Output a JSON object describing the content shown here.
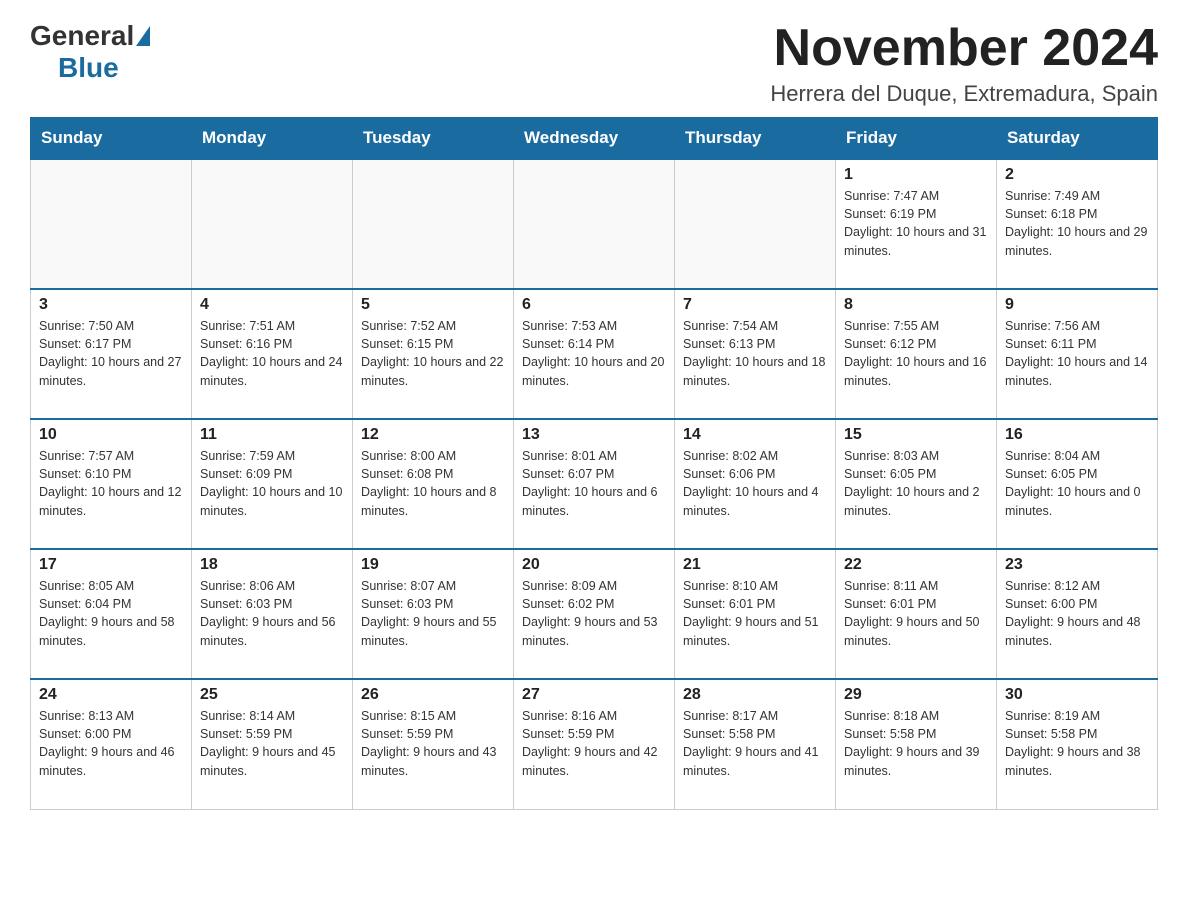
{
  "logo": {
    "general": "General",
    "blue": "Blue"
  },
  "title": "November 2024",
  "location": "Herrera del Duque, Extremadura, Spain",
  "weekdays": [
    "Sunday",
    "Monday",
    "Tuesday",
    "Wednesday",
    "Thursday",
    "Friday",
    "Saturday"
  ],
  "weeks": [
    [
      {
        "day": "",
        "info": ""
      },
      {
        "day": "",
        "info": ""
      },
      {
        "day": "",
        "info": ""
      },
      {
        "day": "",
        "info": ""
      },
      {
        "day": "",
        "info": ""
      },
      {
        "day": "1",
        "info": "Sunrise: 7:47 AM\nSunset: 6:19 PM\nDaylight: 10 hours and 31 minutes."
      },
      {
        "day": "2",
        "info": "Sunrise: 7:49 AM\nSunset: 6:18 PM\nDaylight: 10 hours and 29 minutes."
      }
    ],
    [
      {
        "day": "3",
        "info": "Sunrise: 7:50 AM\nSunset: 6:17 PM\nDaylight: 10 hours and 27 minutes."
      },
      {
        "day": "4",
        "info": "Sunrise: 7:51 AM\nSunset: 6:16 PM\nDaylight: 10 hours and 24 minutes."
      },
      {
        "day": "5",
        "info": "Sunrise: 7:52 AM\nSunset: 6:15 PM\nDaylight: 10 hours and 22 minutes."
      },
      {
        "day": "6",
        "info": "Sunrise: 7:53 AM\nSunset: 6:14 PM\nDaylight: 10 hours and 20 minutes."
      },
      {
        "day": "7",
        "info": "Sunrise: 7:54 AM\nSunset: 6:13 PM\nDaylight: 10 hours and 18 minutes."
      },
      {
        "day": "8",
        "info": "Sunrise: 7:55 AM\nSunset: 6:12 PM\nDaylight: 10 hours and 16 minutes."
      },
      {
        "day": "9",
        "info": "Sunrise: 7:56 AM\nSunset: 6:11 PM\nDaylight: 10 hours and 14 minutes."
      }
    ],
    [
      {
        "day": "10",
        "info": "Sunrise: 7:57 AM\nSunset: 6:10 PM\nDaylight: 10 hours and 12 minutes."
      },
      {
        "day": "11",
        "info": "Sunrise: 7:59 AM\nSunset: 6:09 PM\nDaylight: 10 hours and 10 minutes."
      },
      {
        "day": "12",
        "info": "Sunrise: 8:00 AM\nSunset: 6:08 PM\nDaylight: 10 hours and 8 minutes."
      },
      {
        "day": "13",
        "info": "Sunrise: 8:01 AM\nSunset: 6:07 PM\nDaylight: 10 hours and 6 minutes."
      },
      {
        "day": "14",
        "info": "Sunrise: 8:02 AM\nSunset: 6:06 PM\nDaylight: 10 hours and 4 minutes."
      },
      {
        "day": "15",
        "info": "Sunrise: 8:03 AM\nSunset: 6:05 PM\nDaylight: 10 hours and 2 minutes."
      },
      {
        "day": "16",
        "info": "Sunrise: 8:04 AM\nSunset: 6:05 PM\nDaylight: 10 hours and 0 minutes."
      }
    ],
    [
      {
        "day": "17",
        "info": "Sunrise: 8:05 AM\nSunset: 6:04 PM\nDaylight: 9 hours and 58 minutes."
      },
      {
        "day": "18",
        "info": "Sunrise: 8:06 AM\nSunset: 6:03 PM\nDaylight: 9 hours and 56 minutes."
      },
      {
        "day": "19",
        "info": "Sunrise: 8:07 AM\nSunset: 6:03 PM\nDaylight: 9 hours and 55 minutes."
      },
      {
        "day": "20",
        "info": "Sunrise: 8:09 AM\nSunset: 6:02 PM\nDaylight: 9 hours and 53 minutes."
      },
      {
        "day": "21",
        "info": "Sunrise: 8:10 AM\nSunset: 6:01 PM\nDaylight: 9 hours and 51 minutes."
      },
      {
        "day": "22",
        "info": "Sunrise: 8:11 AM\nSunset: 6:01 PM\nDaylight: 9 hours and 50 minutes."
      },
      {
        "day": "23",
        "info": "Sunrise: 8:12 AM\nSunset: 6:00 PM\nDaylight: 9 hours and 48 minutes."
      }
    ],
    [
      {
        "day": "24",
        "info": "Sunrise: 8:13 AM\nSunset: 6:00 PM\nDaylight: 9 hours and 46 minutes."
      },
      {
        "day": "25",
        "info": "Sunrise: 8:14 AM\nSunset: 5:59 PM\nDaylight: 9 hours and 45 minutes."
      },
      {
        "day": "26",
        "info": "Sunrise: 8:15 AM\nSunset: 5:59 PM\nDaylight: 9 hours and 43 minutes."
      },
      {
        "day": "27",
        "info": "Sunrise: 8:16 AM\nSunset: 5:59 PM\nDaylight: 9 hours and 42 minutes."
      },
      {
        "day": "28",
        "info": "Sunrise: 8:17 AM\nSunset: 5:58 PM\nDaylight: 9 hours and 41 minutes."
      },
      {
        "day": "29",
        "info": "Sunrise: 8:18 AM\nSunset: 5:58 PM\nDaylight: 9 hours and 39 minutes."
      },
      {
        "day": "30",
        "info": "Sunrise: 8:19 AM\nSunset: 5:58 PM\nDaylight: 9 hours and 38 minutes."
      }
    ]
  ]
}
